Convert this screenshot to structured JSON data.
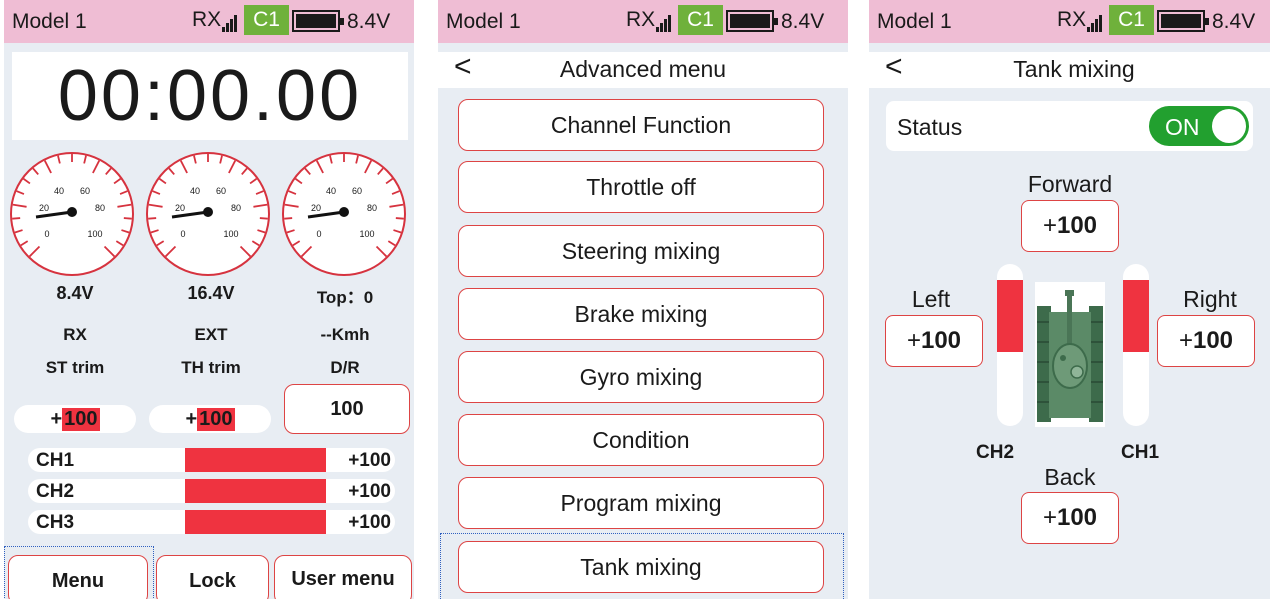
{
  "status_bar": {
    "model": "Model 1",
    "rx": "RX",
    "channel": "C1",
    "voltage": "8.4V"
  },
  "screen1": {
    "timer": "00:00.00",
    "gauges": [
      {
        "ticks": [
          "40",
          "60",
          "20",
          "80",
          "0",
          "100"
        ],
        "reading": "8.4V",
        "source": "RX"
      },
      {
        "ticks": [
          "40",
          "60",
          "20",
          "80",
          "0",
          "100"
        ],
        "reading": "16.4V",
        "source": "EXT"
      },
      {
        "ticks": [
          "40",
          "60",
          "20",
          "80",
          "0",
          "100"
        ],
        "reading": "Top：0",
        "source": "--Kmh"
      }
    ],
    "st_trim": {
      "label": "ST trim",
      "sign": "+",
      "value": "100"
    },
    "th_trim": {
      "label": "TH trim",
      "sign": "+",
      "value": "100"
    },
    "dr": {
      "label": "D/R",
      "value": "100"
    },
    "channels": [
      {
        "name": "CH1",
        "value": "+100"
      },
      {
        "name": "CH2",
        "value": "+100"
      },
      {
        "name": "CH3",
        "value": "+100"
      }
    ],
    "buttons": {
      "menu": "Menu",
      "lock": "Lock",
      "user_menu": "User menu"
    }
  },
  "screen2": {
    "back": "<",
    "title": "Advanced menu",
    "items": [
      "Channel Function",
      "Throttle off",
      "Steering mixing",
      "Brake mixing",
      "Gyro mixing",
      "Condition",
      "Program mixing",
      "Tank mixing"
    ]
  },
  "screen3": {
    "back": "<",
    "title": "Tank mixing",
    "status_label": "Status",
    "status_value": "ON",
    "forward": {
      "label": "Forward",
      "sign": "+",
      "value": "100"
    },
    "left": {
      "label": "Left",
      "sign": "+",
      "value": "100"
    },
    "right": {
      "label": "Right",
      "sign": "+",
      "value": "100"
    },
    "back_dir": {
      "label": "Back",
      "sign": "+",
      "value": "100"
    },
    "ch2": "CH2",
    "ch1": "CH1"
  },
  "colors": {
    "statusbar": "#efbdd4",
    "accent_red": "#ef3340",
    "c1_green": "#6fb13b",
    "toggle_green": "#22a02f",
    "background": "#e8edf3"
  }
}
